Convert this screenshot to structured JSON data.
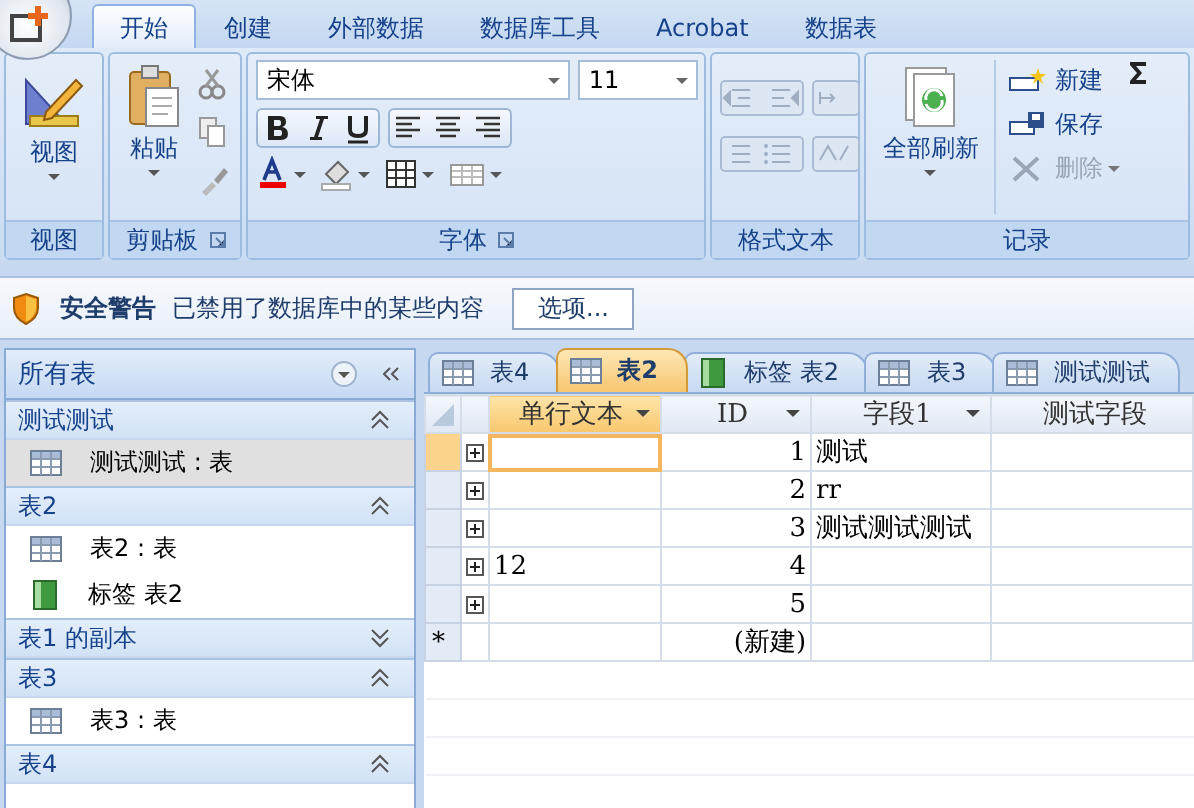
{
  "ribbon_tabs": [
    {
      "label": "开始",
      "selected": true
    },
    {
      "label": "创建",
      "selected": false
    },
    {
      "label": "外部数据",
      "selected": false
    },
    {
      "label": "数据库工具",
      "selected": false
    },
    {
      "label": "Acrobat",
      "selected": false
    },
    {
      "label": "数据表",
      "selected": false
    }
  ],
  "view_group": {
    "label": "视图",
    "button": "视图"
  },
  "clipboard_group": {
    "label": "剪贴板",
    "paste": "粘贴"
  },
  "font_group": {
    "label": "字体",
    "font": "宋体",
    "size": "11"
  },
  "rich_text_group": {
    "label": "格式文本"
  },
  "records_group": {
    "label": "记录",
    "refresh": "全部刷新",
    "actions": [
      {
        "label": "新建",
        "kind": "new",
        "disabled": false
      },
      {
        "label": "保存",
        "kind": "save",
        "disabled": false
      },
      {
        "label": "删除",
        "kind": "delete",
        "disabled": true
      }
    ]
  },
  "security_bar": {
    "title": "安全警告",
    "message": "已禁用了数据库中的某些内容",
    "button": "选项..."
  },
  "nav_pane": {
    "title": "所有表",
    "groups": [
      {
        "label": "测试测试",
        "expanded": true,
        "items": [
          {
            "label": "测试测试 : 表",
            "kind": "table",
            "selected": true
          }
        ]
      },
      {
        "label": "表2",
        "expanded": true,
        "items": [
          {
            "label": "表2 : 表",
            "kind": "table",
            "selected": false
          },
          {
            "label": "标签 表2",
            "kind": "report",
            "selected": false
          }
        ]
      },
      {
        "label": "表1 的副本",
        "expanded": false
      },
      {
        "label": "表3",
        "expanded": true,
        "items": [
          {
            "label": "表3 : 表",
            "kind": "table",
            "selected": false
          }
        ]
      },
      {
        "label": "表4",
        "expanded": true
      }
    ]
  },
  "doc_tabs": [
    {
      "label": "表4",
      "kind": "table",
      "selected": false
    },
    {
      "label": "表2",
      "kind": "table",
      "selected": true
    },
    {
      "label": "标签 表2",
      "kind": "report",
      "selected": false
    },
    {
      "label": "表3",
      "kind": "table",
      "selected": false
    },
    {
      "label": "测试测试",
      "kind": "table",
      "selected": false
    }
  ],
  "datasheet": {
    "columns": [
      {
        "label": "单行文本",
        "selected": true
      },
      {
        "label": "ID",
        "selected": false
      },
      {
        "label": "字段1",
        "selected": false
      },
      {
        "label": "测试字段",
        "selected": false
      }
    ],
    "rows": [
      {
        "kind": "record",
        "selected": true,
        "cells": [
          "",
          "1",
          "测试",
          ""
        ]
      },
      {
        "kind": "record",
        "selected": false,
        "cells": [
          "",
          "2",
          "rr",
          ""
        ]
      },
      {
        "kind": "record",
        "selected": false,
        "cells": [
          "",
          "3",
          "测试测试测试",
          ""
        ]
      },
      {
        "kind": "record",
        "selected": false,
        "cells": [
          "12",
          "4",
          "",
          ""
        ]
      },
      {
        "kind": "record",
        "selected": false,
        "cells": [
          "",
          "5",
          "",
          ""
        ]
      },
      {
        "kind": "new",
        "marker": "*",
        "selected": false,
        "cells": [
          "",
          "(新建)",
          "",
          ""
        ]
      }
    ]
  }
}
